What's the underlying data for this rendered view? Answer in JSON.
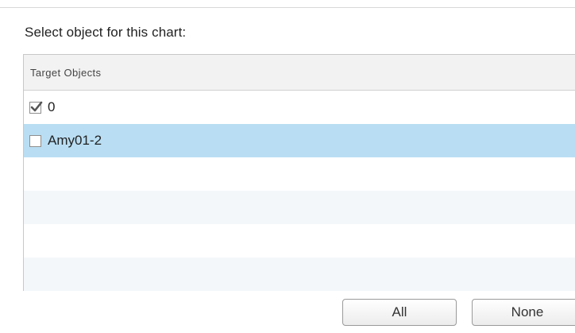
{
  "dialog": {
    "prompt": "Select object for this chart:"
  },
  "grid": {
    "column_header": "Target Objects",
    "rows": [
      {
        "label": "0",
        "checked": true,
        "selected": false
      },
      {
        "label": "Amy01-2",
        "checked": false,
        "selected": true
      }
    ]
  },
  "buttons": {
    "all_label": "All",
    "none_label": "None"
  },
  "colors": {
    "selected_row": "#b9def3",
    "alt_row": "#f4f7fa",
    "header_bg": "#f2f2f2",
    "checkmark": "#555555"
  }
}
